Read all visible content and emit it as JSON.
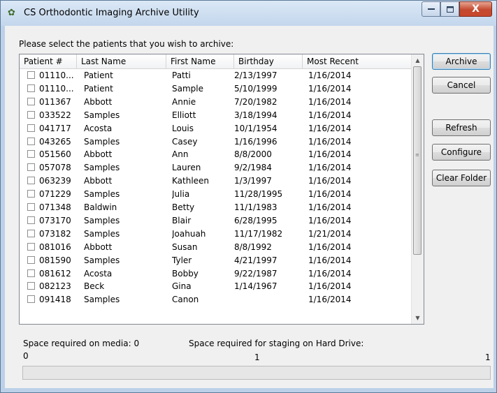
{
  "window": {
    "title": "CS Orthodontic Imaging Archive Utility",
    "caption_buttons": {
      "minimize": "–",
      "maximize": "□",
      "close": "X"
    }
  },
  "prompt": "Please select the patients that you wish to archive:",
  "table": {
    "columns": [
      "Patient #",
      "Last Name",
      "First Name",
      "Birthday",
      "Most Recent"
    ],
    "rows": [
      {
        "id": "01110...",
        "last": "Patient",
        "first": "Patti",
        "birthday": "2/13/1997",
        "recent": "1/16/2014"
      },
      {
        "id": "01110...",
        "last": "Patient",
        "first": "Sample",
        "birthday": "5/10/1999",
        "recent": "1/16/2014"
      },
      {
        "id": "011367",
        "last": "Abbott",
        "first": "Annie",
        "birthday": "7/20/1982",
        "recent": "1/16/2014"
      },
      {
        "id": "033522",
        "last": "Samples",
        "first": "Elliott",
        "birthday": "3/18/1994",
        "recent": "1/16/2014"
      },
      {
        "id": "041717",
        "last": "Acosta",
        "first": "Louis",
        "birthday": "10/1/1954",
        "recent": "1/16/2014"
      },
      {
        "id": "043265",
        "last": "Samples",
        "first": "Casey",
        "birthday": "1/16/1996",
        "recent": "1/16/2014"
      },
      {
        "id": "051560",
        "last": "Abbott",
        "first": "Ann",
        "birthday": "8/8/2000",
        "recent": "1/16/2014"
      },
      {
        "id": "057078",
        "last": "Samples",
        "first": "Lauren",
        "birthday": "9/2/1984",
        "recent": "1/16/2014"
      },
      {
        "id": "063239",
        "last": "Abbott",
        "first": "Kathleen",
        "birthday": "1/3/1997",
        "recent": "1/16/2014"
      },
      {
        "id": "071229",
        "last": "Samples",
        "first": "Julia",
        "birthday": "11/28/1995",
        "recent": "1/16/2014"
      },
      {
        "id": "071348",
        "last": "Baldwin",
        "first": "Betty",
        "birthday": "11/1/1983",
        "recent": "1/16/2014"
      },
      {
        "id": "073170",
        "last": "Samples",
        "first": "Blair",
        "birthday": "6/28/1995",
        "recent": "1/16/2014"
      },
      {
        "id": "073182",
        "last": "Samples",
        "first": "Joahuah",
        "birthday": "11/17/1982",
        "recent": "1/21/2014"
      },
      {
        "id": "081016",
        "last": "Abbott",
        "first": "Susan",
        "birthday": "8/8/1992",
        "recent": "1/16/2014"
      },
      {
        "id": "081590",
        "last": "Samples",
        "first": "Tyler",
        "birthday": "4/21/1997",
        "recent": "1/16/2014"
      },
      {
        "id": "081612",
        "last": "Acosta",
        "first": "Bobby",
        "birthday": "9/22/1987",
        "recent": "1/16/2014"
      },
      {
        "id": "082123",
        "last": "Beck",
        "first": "Gina",
        "birthday": "1/14/1967",
        "recent": "1/16/2014"
      },
      {
        "id": "091418",
        "last": "Samples",
        "first": "Canon",
        "birthday": "",
        "recent": "1/16/2014"
      }
    ]
  },
  "buttons": {
    "archive": "Archive",
    "cancel": "Cancel",
    "refresh": "Refresh",
    "configure": "Configure",
    "clear_folder": "Clear Folder"
  },
  "status": {
    "space_media_label": "Space required on media: 0",
    "space_staging_label": "Space required for staging on Hard Drive:",
    "scale_min": "0",
    "scale_mid": "1",
    "scale_max": "1"
  },
  "progress": 0,
  "icons": {
    "app": "app-icon",
    "scroll_up": "scroll-up-arrow-icon",
    "scroll_down": "scroll-down-arrow-icon"
  },
  "colors": {
    "titlebar": "#c3d6ec",
    "close_button": "#c44a2f",
    "dialog_bg": "#f0f0f0"
  }
}
